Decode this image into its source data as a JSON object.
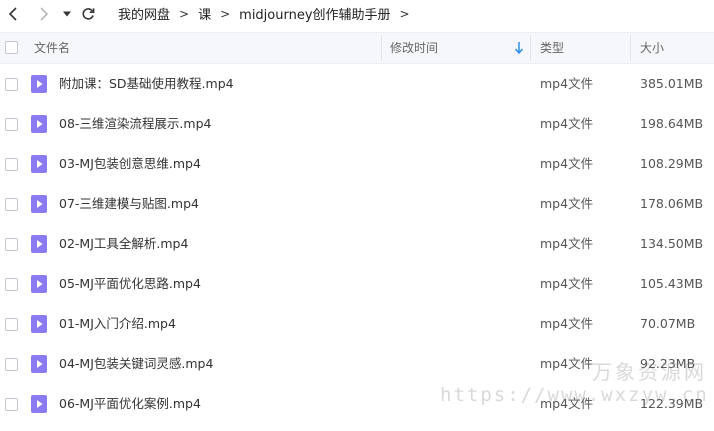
{
  "toolbar": {
    "breadcrumbs": [
      "我的网盘",
      "课",
      "midjourney创作辅助手册"
    ]
  },
  "table": {
    "columns": {
      "name": "文件名",
      "modified": "修改时间",
      "type": "类型",
      "size": "大小"
    },
    "sort": "descending"
  },
  "files": [
    {
      "name": "附加课：SD基础使用教程.mp4",
      "type": "mp4文件",
      "size": "385.01MB"
    },
    {
      "name": "08-三维渲染流程展示.mp4",
      "type": "mp4文件",
      "size": "198.64MB"
    },
    {
      "name": "03-MJ包装创意思维.mp4",
      "type": "mp4文件",
      "size": "108.29MB"
    },
    {
      "name": "07-三维建模与贴图.mp4",
      "type": "mp4文件",
      "size": "178.06MB"
    },
    {
      "name": "02-MJ工具全解析.mp4",
      "type": "mp4文件",
      "size": "134.50MB"
    },
    {
      "name": "05-MJ平面优化思路.mp4",
      "type": "mp4文件",
      "size": "105.43MB"
    },
    {
      "name": "01-MJ入门介绍.mp4",
      "type": "mp4文件",
      "size": "70.07MB"
    },
    {
      "name": "04-MJ包装关键词灵感.mp4",
      "type": "mp4文件",
      "size": "92.23MB"
    },
    {
      "name": "06-MJ平面优化案例.mp4",
      "type": "mp4文件",
      "size": "122.39MB"
    }
  ],
  "watermark": {
    "title": "万象资源网",
    "url": "https://www.wxzyw.cn"
  },
  "colors": {
    "file_icon": "#8a7cf0",
    "sort_arrow": "#2f8cf3",
    "header_bg": "#f6f7fa"
  },
  "icons": {
    "back": "chevron-left-icon",
    "forward": "chevron-right-icon",
    "history": "caret-down-icon",
    "refresh": "refresh-icon",
    "file": "video-file-icon"
  }
}
